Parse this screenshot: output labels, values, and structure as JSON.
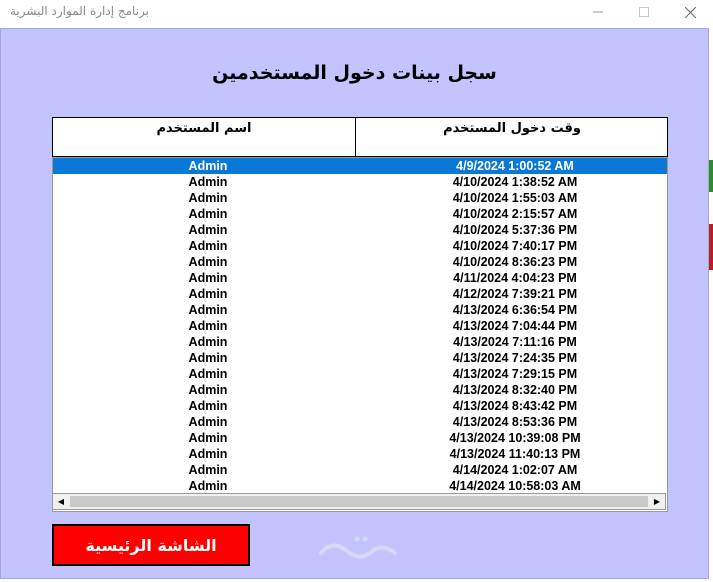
{
  "window": {
    "title": "برنامج إدارة الموارد البشرية",
    "minimize_icon": "minimize-icon",
    "maximize_icon": "maximize-icon",
    "close_icon": "close-icon"
  },
  "form": {
    "background_color": "#c3c3ff",
    "title": "سجل بينات دخول المستخدمين",
    "columns": {
      "login_time": "وقت دخول المستخدم",
      "user_name": "اسم المستخدم"
    },
    "rows": [
      {
        "user": "Admin",
        "time": "4/9/2024 1:00:52 AM",
        "selected": true
      },
      {
        "user": "Admin",
        "time": "4/10/2024 1:38:52 AM"
      },
      {
        "user": "Admin",
        "time": "4/10/2024 1:55:03 AM"
      },
      {
        "user": "Admin",
        "time": "4/10/2024 2:15:57 AM"
      },
      {
        "user": "Admin",
        "time": "4/10/2024 5:37:36 PM"
      },
      {
        "user": "Admin",
        "time": "4/10/2024 7:40:17 PM"
      },
      {
        "user": "Admin",
        "time": "4/10/2024 8:36:23 PM"
      },
      {
        "user": "Admin",
        "time": "4/11/2024 4:04:23 PM"
      },
      {
        "user": "Admin",
        "time": "4/12/2024 7:39:21 PM"
      },
      {
        "user": "Admin",
        "time": "4/13/2024 6:36:54 PM"
      },
      {
        "user": "Admin",
        "time": "4/13/2024 7:04:44 PM"
      },
      {
        "user": "Admin",
        "time": "4/13/2024 7:11:16 PM"
      },
      {
        "user": "Admin",
        "time": "4/13/2024 7:24:35 PM"
      },
      {
        "user": "Admin",
        "time": "4/13/2024 7:29:15 PM"
      },
      {
        "user": "Admin",
        "time": "4/13/2024 8:32:40 PM"
      },
      {
        "user": "Admin",
        "time": "4/13/2024 8:43:42 PM"
      },
      {
        "user": "Admin",
        "time": "4/13/2024 8:53:36 PM"
      },
      {
        "user": "Admin",
        "time": "4/13/2024 10:39:08 PM"
      },
      {
        "user": "Admin",
        "time": "4/13/2024 11:40:13 PM"
      },
      {
        "user": "Admin",
        "time": "4/14/2024 1:02:07 AM"
      },
      {
        "user": "Admin",
        "time": "4/14/2024 10:58:03 AM"
      }
    ],
    "selection_color": "#0a78d7",
    "home_button": {
      "label": "الشاشة الرئيسية",
      "color": "#ff0000"
    }
  }
}
